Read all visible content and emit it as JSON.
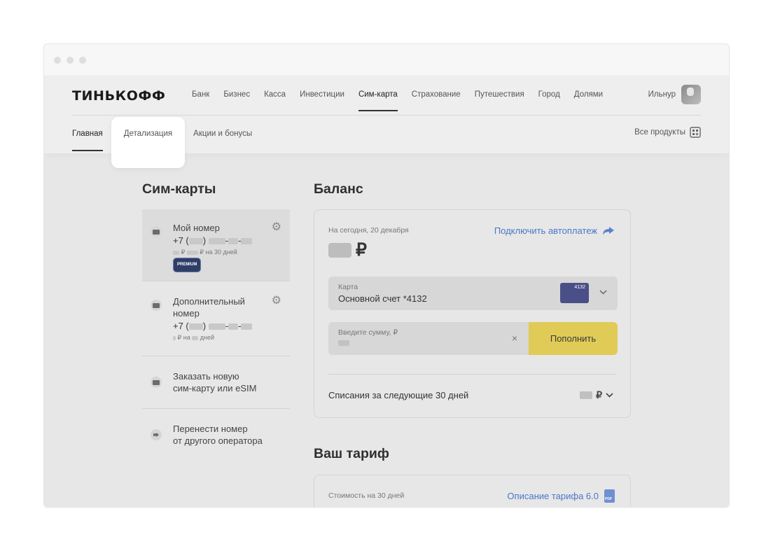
{
  "header": {
    "logo": "ТИНЬКОФФ",
    "nav": [
      "Банк",
      "Бизнес",
      "Касса",
      "Инвестиции",
      "Сим-карта",
      "Страхование",
      "Путешествия",
      "Город",
      "Долями"
    ],
    "active_nav": "Сим-карта",
    "user_name": "Ильнур"
  },
  "subnav": {
    "items": [
      "Главная",
      "Детализация",
      "Акции и бонусы"
    ],
    "active": "Главная",
    "highlighted": "Детализация",
    "all_products": "Все продукты"
  },
  "sims": {
    "title": "Сим-карты",
    "items": [
      {
        "label": "Мой номер",
        "number_prefix": "+7 (",
        "price_line": "₽ на 30 дней",
        "badge": "PREMIUM"
      },
      {
        "label_line1": "Дополнительный",
        "label_line2": "номер",
        "number_prefix": "+7 (",
        "price_line": "₽ на",
        "price_suffix": "дней"
      },
      {
        "line1": "Заказать новую",
        "line2": "сим-карту или eSIM"
      },
      {
        "line1": "Перенести номер",
        "line2": "от другого оператора"
      }
    ]
  },
  "balance": {
    "title": "Баланс",
    "date": "На сегодня, 20 декабря",
    "autopay": "Подключить автоплатеж",
    "currency": "₽",
    "card_label": "Карта",
    "card_value": "Основной счет *4132",
    "card_digits": "4132",
    "amount_label": "Введите сумму, ₽",
    "clear": "×",
    "topup": "Пополнить",
    "charges": "Списания за следующие 30 дней",
    "charges_currency": "₽"
  },
  "tariff": {
    "title": "Ваш тариф",
    "cost_label": "Стоимость на 30 дней",
    "description": "Описание тарифа 6.0"
  },
  "colors": {
    "accent_yellow": "#e0cb57",
    "link_blue": "#4b77c9",
    "card_blue": "#4a4f88"
  }
}
